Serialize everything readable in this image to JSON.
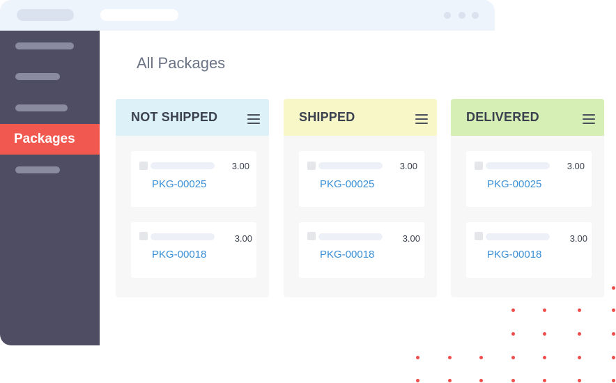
{
  "page": {
    "title": "All Packages"
  },
  "sidebar": {
    "active_item": "Packages"
  },
  "columns": [
    {
      "title": "NOT SHIPPED",
      "color": "#dcf1f8",
      "cards": [
        {
          "id": "PKG-00025",
          "qty": "3.00"
        },
        {
          "id": "PKG-00018",
          "qty": "3.00"
        }
      ]
    },
    {
      "title": "SHIPPED",
      "color": "#f8f7c8",
      "cards": [
        {
          "id": "PKG-00025",
          "qty": "3.00"
        },
        {
          "id": "PKG-00018",
          "qty": "3.00"
        }
      ]
    },
    {
      "title": "DELIVERED",
      "color": "#d6efb4",
      "cards": [
        {
          "id": "PKG-00025",
          "qty": "3.00"
        },
        {
          "id": "PKG-00018",
          "qty": "3.00"
        }
      ]
    }
  ],
  "colors": {
    "accent": "#f1584f",
    "sidebar": "#4e4d63",
    "link": "#3a8fd6"
  },
  "icons": {
    "column_menu": "hamburger-menu-icon"
  }
}
